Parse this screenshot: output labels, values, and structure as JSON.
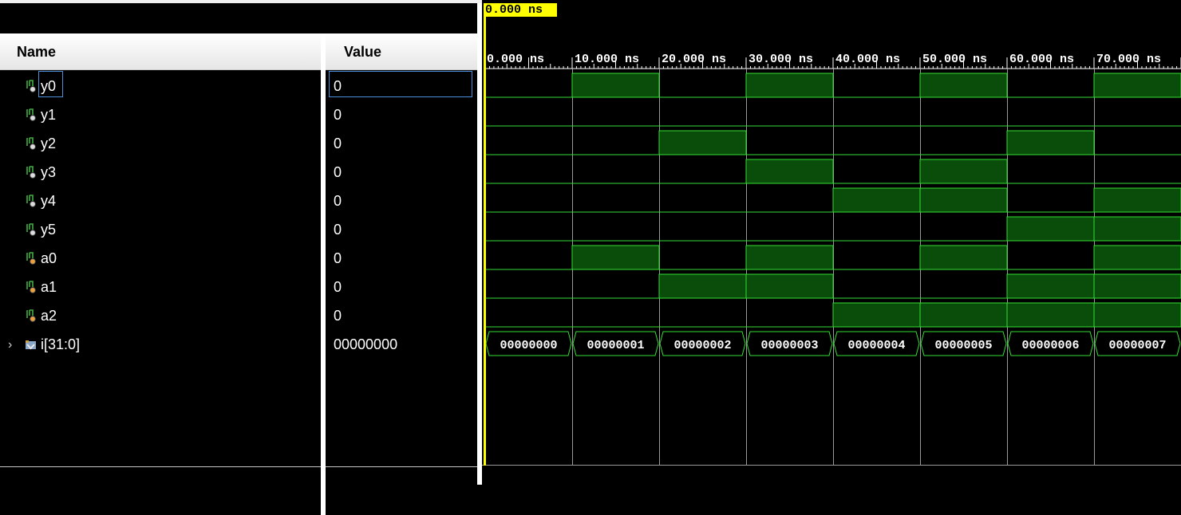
{
  "header": {
    "name_col": "Name",
    "value_col": "Value"
  },
  "cursor": {
    "label": "0.000 ns"
  },
  "timeline": {
    "tick_labels": [
      "0.000 ns",
      "10.000 ns",
      "20.000 ns",
      "30.000 ns",
      "40.000 ns",
      "50.000 ns",
      "60.000 ns",
      "70.000 ns"
    ]
  },
  "signals": [
    {
      "name": "y0",
      "value": "0",
      "kind": "output",
      "wave": [
        0,
        1,
        0,
        1,
        0,
        1,
        0,
        1
      ]
    },
    {
      "name": "y1",
      "value": "0",
      "kind": "output",
      "wave": [
        0,
        0,
        0,
        0,
        0,
        0,
        0,
        0
      ]
    },
    {
      "name": "y2",
      "value": "0",
      "kind": "output",
      "wave": [
        0,
        0,
        1,
        0,
        0,
        0,
        1,
        0
      ]
    },
    {
      "name": "y3",
      "value": "0",
      "kind": "output",
      "wave": [
        0,
        0,
        0,
        1,
        0,
        1,
        0,
        0
      ]
    },
    {
      "name": "y4",
      "value": "0",
      "kind": "output",
      "wave": [
        0,
        0,
        0,
        0,
        1,
        1,
        0,
        1
      ]
    },
    {
      "name": "y5",
      "value": "0",
      "kind": "output",
      "wave": [
        0,
        0,
        0,
        0,
        0,
        0,
        1,
        1
      ]
    },
    {
      "name": "a0",
      "value": "0",
      "kind": "input",
      "wave": [
        0,
        1,
        0,
        1,
        0,
        1,
        0,
        1
      ]
    },
    {
      "name": "a1",
      "value": "0",
      "kind": "input",
      "wave": [
        0,
        0,
        1,
        1,
        0,
        0,
        1,
        1
      ]
    },
    {
      "name": "a2",
      "value": "0",
      "kind": "input",
      "wave": [
        0,
        0,
        0,
        0,
        1,
        1,
        1,
        1
      ]
    }
  ],
  "bus": {
    "name": "i[31:0]",
    "value": "00000000",
    "segments": [
      "00000000",
      "00000001",
      "00000002",
      "00000003",
      "00000004",
      "00000005",
      "00000006",
      "00000007"
    ]
  },
  "colors": {
    "wave_line": "#33dd33",
    "wave_fill": "#0a4d0a",
    "grid": "#9a9a9a",
    "cursor": "#ffff00",
    "selection": "#4a90d9"
  }
}
